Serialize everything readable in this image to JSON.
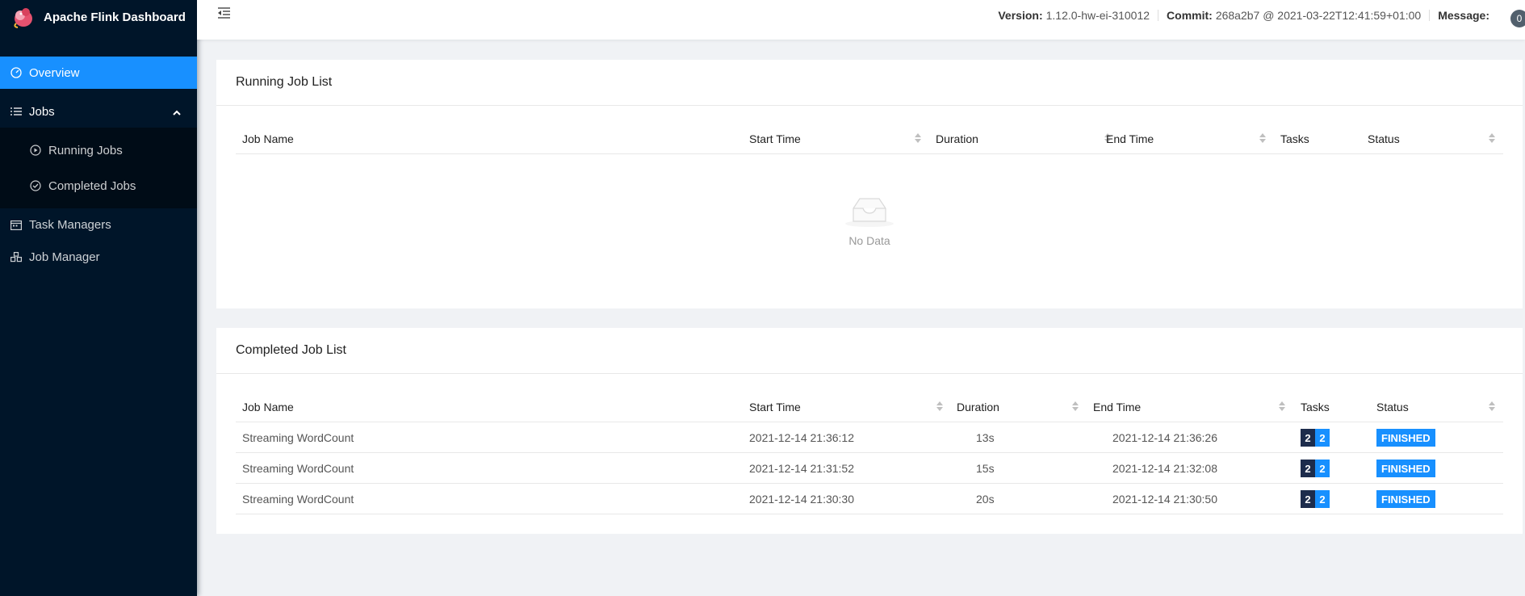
{
  "brand": {
    "title": "Apache Flink Dashboard"
  },
  "sidebar": {
    "items": [
      {
        "label": "Overview",
        "icon": "dashboard-icon"
      },
      {
        "label": "Jobs",
        "icon": "list-icon"
      },
      {
        "label": "Running Jobs",
        "icon": "play-circle-icon"
      },
      {
        "label": "Completed Jobs",
        "icon": "check-circle-icon"
      },
      {
        "label": "Task Managers",
        "icon": "schedule-icon"
      },
      {
        "label": "Job Manager",
        "icon": "cluster-icon"
      }
    ]
  },
  "header": {
    "version_label": "Version:",
    "version_value": "1.12.0-hw-ei-310012",
    "commit_label": "Commit:",
    "commit_value": "268a2b7 @ 2021-03-22T12:41:59+01:00",
    "message_label": "Message:",
    "message_count": "0"
  },
  "running": {
    "title": "Running Job List",
    "columns": [
      "Job Name",
      "Start Time",
      "Duration",
      "End Time",
      "Tasks",
      "Status"
    ],
    "empty_text": "No Data"
  },
  "completed": {
    "title": "Completed Job List",
    "columns": [
      "Job Name",
      "Start Time",
      "Duration",
      "End Time",
      "Tasks",
      "Status"
    ],
    "rows": [
      {
        "name": "Streaming WordCount",
        "start": "2021-12-14 21:36:12",
        "duration": "13s",
        "end": "2021-12-14 21:36:26",
        "tasks_a": "2",
        "tasks_b": "2",
        "status": "FINISHED"
      },
      {
        "name": "Streaming WordCount",
        "start": "2021-12-14 21:31:52",
        "duration": "15s",
        "end": "2021-12-14 21:32:08",
        "tasks_a": "2",
        "tasks_b": "2",
        "status": "FINISHED"
      },
      {
        "name": "Streaming WordCount",
        "start": "2021-12-14 21:30:30",
        "duration": "20s",
        "end": "2021-12-14 21:30:50",
        "tasks_a": "2",
        "tasks_b": "2",
        "status": "FINISHED"
      }
    ]
  },
  "colors": {
    "sidebar_bg": "#001529",
    "accent": "#1890ff",
    "task_dark": "#1d2c4c"
  }
}
